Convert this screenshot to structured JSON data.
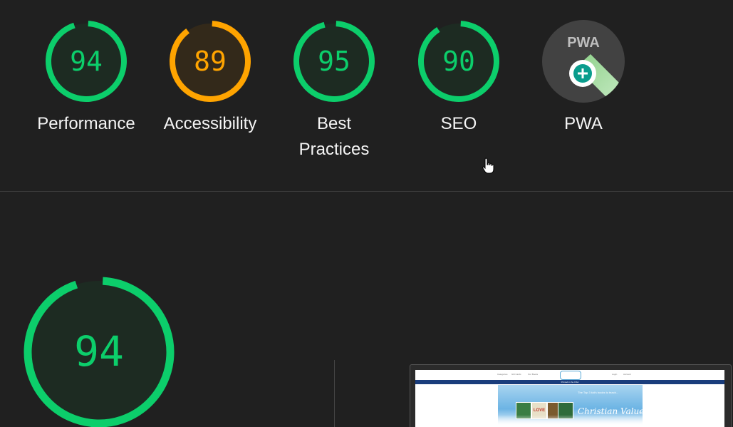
{
  "categories": [
    {
      "key": "performance",
      "label": "Performance",
      "score": "94",
      "value": 94,
      "color": "#0cce6b",
      "bg": "#1d2b22"
    },
    {
      "key": "accessibility",
      "label": "Accessibility",
      "score": "89",
      "value": 89,
      "color": "#ffa400",
      "bg": "#33291a"
    },
    {
      "key": "best-practices",
      "label": "Best Practices",
      "score": "95",
      "value": 95,
      "color": "#0cce6b",
      "bg": "#1d2b22"
    },
    {
      "key": "seo",
      "label": "SEO",
      "score": "90",
      "value": 90,
      "color": "#0cce6b",
      "bg": "#1d2b22"
    }
  ],
  "pwa": {
    "label": "PWA",
    "badge_text": "PWA",
    "icon": "plus-icon"
  },
  "overall": {
    "score": "94",
    "value": 94,
    "color": "#0cce6b"
  },
  "preview": {
    "nav_items": [
      "Categories",
      "Gift Cards",
      "Our Books",
      "Login",
      "Account"
    ],
    "banner": "Printed in the USA",
    "hero_tagline": "The Top 3 kid's books to teach...",
    "hero_title": "Christian Values",
    "book_titles": [
      "LOVE"
    ]
  },
  "colors": {
    "pass": "#0cce6b",
    "average": "#ffa400",
    "background": "#202020"
  }
}
